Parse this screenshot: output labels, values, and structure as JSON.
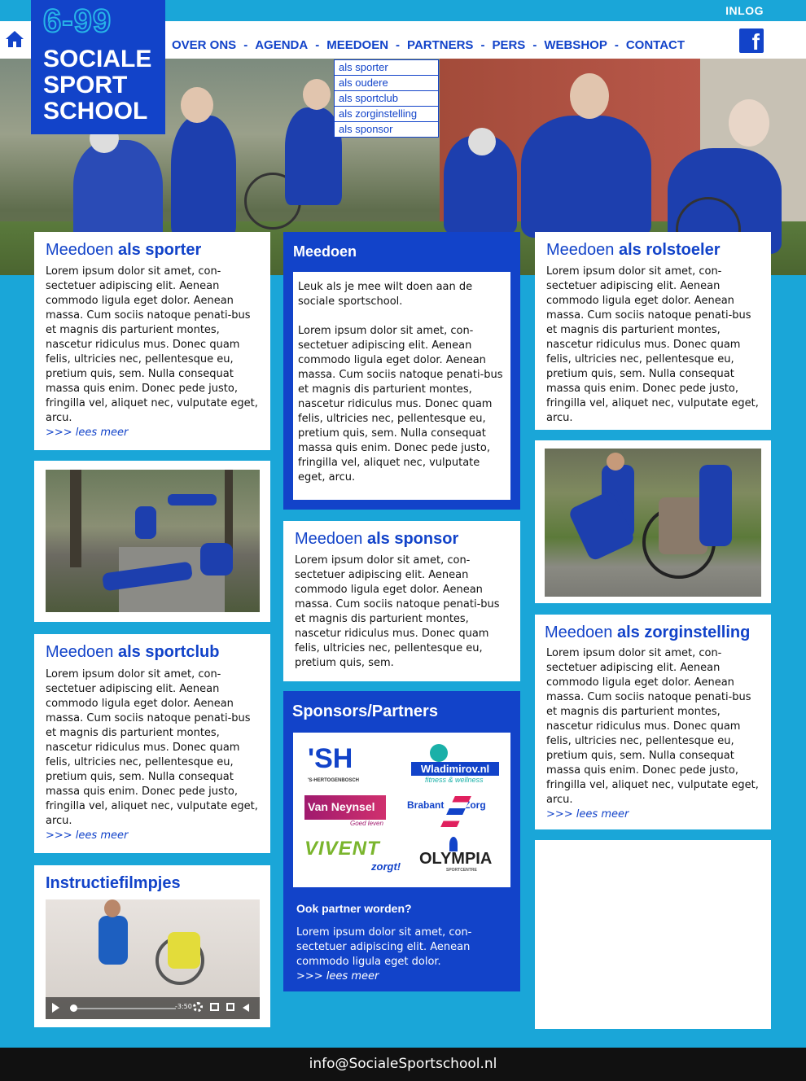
{
  "header": {
    "inlog": "INLOG",
    "logo_number": "6-99",
    "logo_lines": [
      "SOCIALE",
      "SPORT",
      "SCHOOL"
    ],
    "nav": [
      "OVER ONS",
      "AGENDA",
      "MEEDOEN",
      "PARTNERS",
      "PERS",
      "WEBSHOP",
      "CONTACT"
    ],
    "nav_separator": "-",
    "facebook": "f"
  },
  "dropdown": [
    "als sporter",
    "als oudere",
    "als sportclub",
    "als zorginstelling",
    "als sponsor"
  ],
  "cards": {
    "sporter": {
      "title_a": "Meedoen ",
      "title_b": "als sporter",
      "text": "Lorem ipsum dolor sit amet, con-sectetuer adipiscing elit. Aenean commodo ligula eget dolor. Aenean massa. Cum sociis natoque penati-bus et magnis dis parturient montes, nascetur ridiculus mus. Donec quam felis, ultricies nec, pellentesque eu, pretium quis, sem. Nulla consequat massa quis enim. Donec pede justo, fringilla vel, aliquet nec, vulputate eget, arcu.",
      "more": ">>> lees meer"
    },
    "sportclub": {
      "title_a": "Meedoen ",
      "title_b": "als sportclub",
      "text": "Lorem ipsum dolor sit amet, con-sectetuer adipiscing elit. Aenean commodo ligula eget dolor. Aenean massa. Cum sociis natoque penati-bus et magnis dis parturient montes, nascetur ridiculus mus. Donec quam felis, ultricies nec, pellentesque eu, pretium quis, sem. Nulla consequat massa quis enim. Donec pede justo, fringilla vel, aliquet nec, vulputate eget, arcu.",
      "more": ">>> lees meer"
    },
    "rolstoeler": {
      "title_a": "Meedoen ",
      "title_b": "als rolstoeler",
      "text": "Lorem ipsum dolor sit amet, con-sectetuer adipiscing elit. Aenean commodo ligula eget dolor. Aenean massa. Cum sociis natoque penati-bus et magnis dis parturient montes, nascetur ridiculus mus. Donec quam felis, ultricies nec, pellentesque eu, pretium quis, sem. Nulla consequat massa quis enim. Donec pede justo, fringilla vel, aliquet nec, vulputate eget, arcu."
    },
    "sponsor": {
      "title_a": "Meedoen ",
      "title_b": "als sponsor",
      "text": "Lorem ipsum dolor sit amet, con-sectetuer adipiscing elit. Aenean commodo ligula eget dolor. Aenean massa. Cum sociis natoque penati-bus et magnis dis parturient montes, nascetur ridiculus mus. Donec quam felis, ultricies nec, pellentesque eu, pretium quis, sem."
    },
    "zorginstelling": {
      "title_a": "Meedoen ",
      "title_b": "als zorginstelling",
      "text": "Lorem ipsum dolor sit amet, con-sectetuer adipiscing elit. Aenean commodo ligula eget dolor. Aenean massa. Cum sociis natoque penati-bus et magnis dis parturient montes, nascetur ridiculus mus. Donec quam felis, ultricies nec, pellentesque eu, pretium quis, sem. Nulla consequat massa quis enim. Donec pede justo, fringilla vel, aliquet nec, vulputate eget, arcu.",
      "more": ">>> lees meer"
    }
  },
  "meedoen": {
    "title": "Meedoen",
    "intro": "Leuk als je mee wilt doen aan de sociale sportschool.",
    "text": "Lorem ipsum dolor sit amet, con-sectetuer adipiscing elit. Aenean commodo ligula eget dolor. Aenean massa. Cum sociis natoque penati-bus et magnis dis parturient montes, nascetur ridiculus mus. Donec quam felis, ultricies nec, pellentesque eu, pretium quis, sem. Nulla consequat massa quis enim. Donec pede justo, fringilla vel, aliquet nec, vulputate eget, arcu."
  },
  "video": {
    "title": "Instructiefilmpjes",
    "time": "-3:50"
  },
  "sponsors": {
    "title": "Sponsors/Partners",
    "logos": {
      "sh_big": "'SH",
      "sh_small": "'S-HERTOGENBOSCH",
      "wladimirov": "Wladimirov.nl",
      "wladimirov_sub": "fitness & wellness",
      "vanneynsel": "Van Neynsel",
      "vanneynsel_sub": "Goed leven",
      "brabantzorg": "Brabant",
      "brabantzorg_b": "Zorg",
      "vivent": "VIVENT",
      "vivent_sub": "zorgt!",
      "olympia": "OLYMPIA",
      "olympia_sub": "SPORTCENTRE"
    },
    "partner_title": "Ook partner worden?",
    "partner_text": "Lorem ipsum dolor sit amet, con-sectetuer adipiscing elit. Aenean commodo ligula eget dolor.",
    "more": ">>> lees meer"
  },
  "footer": {
    "email": "info@SocialeSportschool.nl"
  },
  "colors": {
    "brand_blue": "#1243c9",
    "sky": "#1aa6d8",
    "footer": "#111111"
  }
}
